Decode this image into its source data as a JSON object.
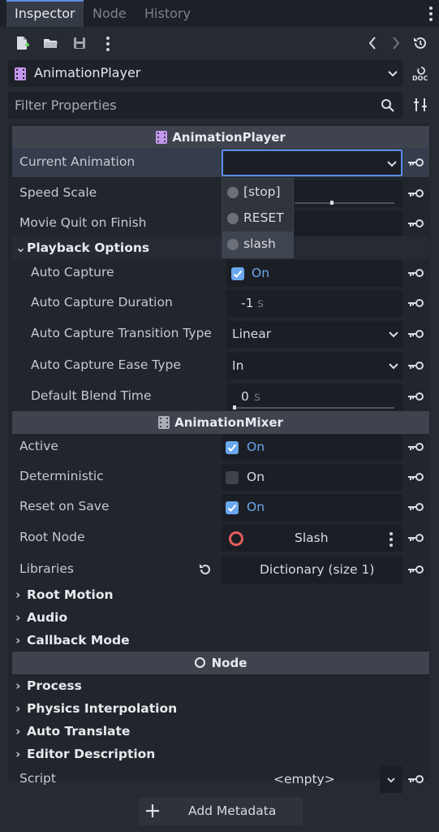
{
  "tabs": [
    {
      "label": "Inspector",
      "active": true
    },
    {
      "label": "Node",
      "active": false
    },
    {
      "label": "History",
      "active": false
    }
  ],
  "toolbar": {
    "icons": [
      "new-resource-icon",
      "open-folder-icon",
      "save-icon",
      "more-icon",
      "back-icon",
      "forward-icon",
      "history-icon"
    ]
  },
  "object": {
    "name": "AnimationPlayer",
    "doc_label": "DOC"
  },
  "filter": {
    "placeholder": "Filter Properties"
  },
  "sections": {
    "animation_player": "AnimationPlayer",
    "animation_mixer": "AnimationMixer",
    "node": "Node"
  },
  "props": {
    "current_animation": {
      "label": "Current Animation",
      "value": ""
    },
    "speed_scale": {
      "label": "Speed Scale"
    },
    "movie_quit": {
      "label": "Movie Quit on Finish"
    },
    "playback_options": "Playback Options",
    "auto_capture": {
      "label": "Auto Capture",
      "value": "On",
      "checked": true
    },
    "auto_capture_duration": {
      "label": "Auto Capture Duration",
      "value": "-1",
      "unit": "s"
    },
    "auto_capture_transition": {
      "label": "Auto Capture Transition Type",
      "value": "Linear"
    },
    "auto_capture_ease": {
      "label": "Auto Capture Ease Type",
      "value": "In"
    },
    "default_blend": {
      "label": "Default Blend Time",
      "value": "0",
      "unit": "s"
    },
    "active": {
      "label": "Active",
      "value": "On",
      "checked": true
    },
    "deterministic": {
      "label": "Deterministic",
      "value": "On",
      "checked": false
    },
    "reset_on_save": {
      "label": "Reset on Save",
      "value": "On",
      "checked": true
    },
    "root_node": {
      "label": "Root Node",
      "value": "Slash"
    },
    "libraries": {
      "label": "Libraries",
      "value": "Dictionary (size 1)"
    },
    "root_motion": "Root Motion",
    "audio": "Audio",
    "callback_mode": "Callback Mode",
    "process": "Process",
    "physics_interpolation": "Physics Interpolation",
    "auto_translate": "Auto Translate",
    "editor_description": "Editor Description",
    "script": {
      "label": "Script",
      "value": "<empty>"
    }
  },
  "dropdown": {
    "items": [
      "[stop]",
      "RESET",
      "slash"
    ],
    "hovered_index": 2
  },
  "add_metadata": {
    "label": "Add Metadata"
  },
  "colors": {
    "accent": "#6aa7ee",
    "focus_border": "#5c8ee6",
    "node_ring": "#e45d5d"
  }
}
